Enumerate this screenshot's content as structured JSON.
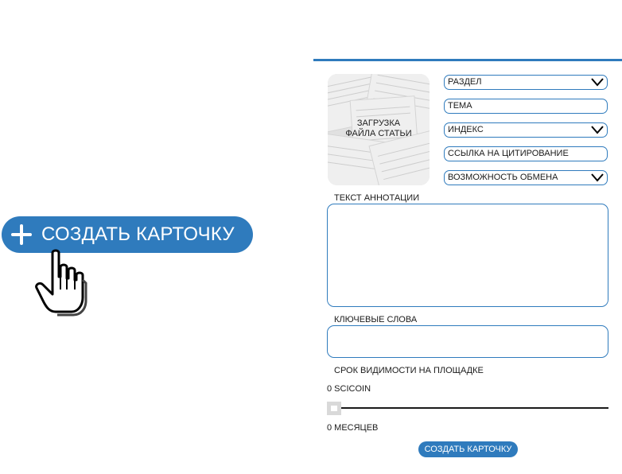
{
  "create_card_big": {
    "label": "СОЗДАТЬ КАРТОЧКУ"
  },
  "upload": {
    "line1": "ЗАГРУЗКА",
    "line2": "ФАЙЛА СТАТЬИ"
  },
  "fields": {
    "section": "РАЗДЕЛ",
    "topic": "ТЕМА",
    "index": "ИНДЕКС",
    "citation_link": "ССЫЛКА НА ЦИТИРОВАНИЕ",
    "exchange": "ВОЗМОЖНОСТЬ ОБМЕНА"
  },
  "annotation": {
    "label": "ТЕКСТ АННОТАЦИИ"
  },
  "keywords": {
    "label": "КЛЮЧЕВЫЕ СЛОВА"
  },
  "visibility": {
    "label": "СРОК ВИДИМОСТИ НА ПЛОЩАДКЕ",
    "price": "0 SCICOIN",
    "months": "0 МЕСЯЦЕВ",
    "slider_fraction": 0
  },
  "create_card_small": {
    "label": "СОЗДАТЬ КАРТОЧКУ"
  },
  "colors": {
    "accent": "#2f7bbd"
  }
}
